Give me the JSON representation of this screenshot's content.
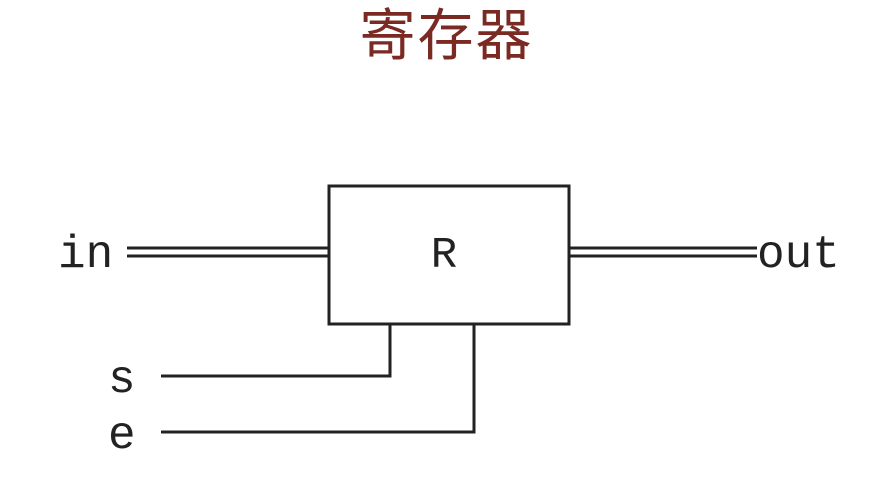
{
  "title": "寄存器",
  "diagram": {
    "register_label": "R",
    "input_label": "in",
    "output_label": "out",
    "select_label": "s",
    "enable_label": "e"
  },
  "colors": {
    "title": "#7a2a22",
    "stroke": "#222222",
    "background": "#ffffff"
  }
}
